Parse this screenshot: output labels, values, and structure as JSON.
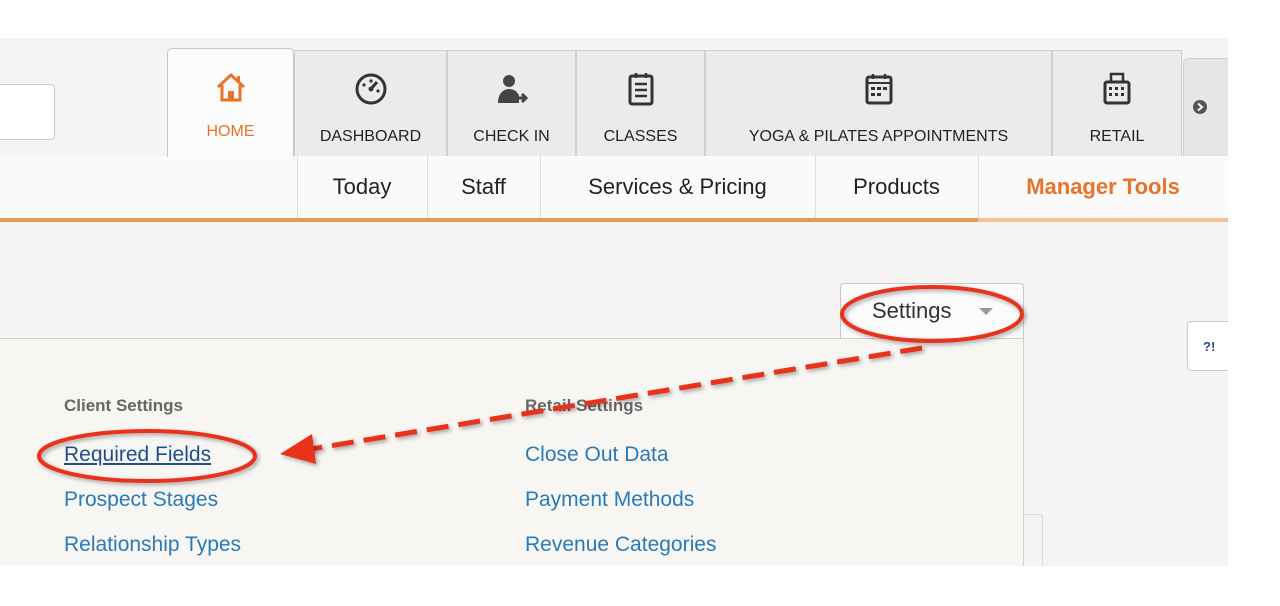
{
  "top_tabs": [
    {
      "label": "HOME",
      "icon": "home-icon"
    },
    {
      "label": "DASHBOARD",
      "icon": "gauge-icon"
    },
    {
      "label": "CHECK IN",
      "icon": "person-arrow-icon"
    },
    {
      "label": "CLASSES",
      "icon": "notepad-icon"
    },
    {
      "label": "YOGA & PILATES APPOINTMENTS",
      "icon": "calendar-icon"
    },
    {
      "label": "RETAIL",
      "icon": "register-icon"
    }
  ],
  "sub_nav": [
    "Today",
    "Staff",
    "Services & Pricing",
    "Products",
    "Manager Tools"
  ],
  "settings_label": "Settings",
  "help_label": "?!",
  "client_settings": {
    "heading": "Client Settings",
    "links": [
      "Required Fields",
      "Prospect Stages",
      "Relationship Types"
    ]
  },
  "retail_settings": {
    "heading": "Retail Settings",
    "links": [
      "Close Out Data",
      "Payment Methods",
      "Revenue Categories"
    ]
  },
  "colors": {
    "accent": "#e8732a",
    "link": "#2a7ab8",
    "annotation": "#e8321c"
  }
}
